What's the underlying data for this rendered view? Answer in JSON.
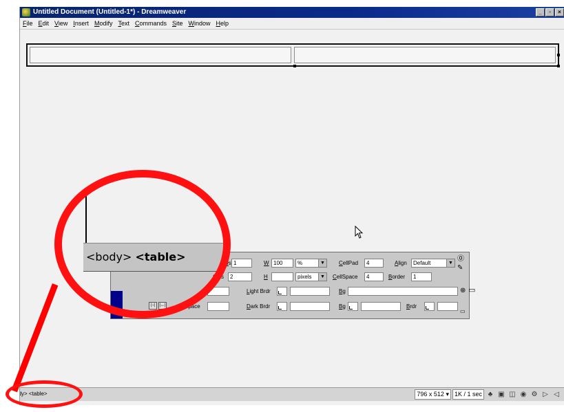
{
  "window": {
    "title": "Untitled Document (Untitled-1*) - Dreamweaver",
    "controls": [
      "_",
      "▫",
      "×"
    ]
  },
  "menu": [
    "File",
    "Edit",
    "View",
    "Insert",
    "Modify",
    "Text",
    "Commands",
    "Site",
    "Window",
    "Help"
  ],
  "properties": {
    "rows_label": "ws",
    "rows_value": "1",
    "w_label": "W",
    "w_value": "100",
    "w_unit": "%",
    "cellpad_label": "CellPad",
    "cellpad_value": "4",
    "align_label": "Align",
    "align_value": "Default",
    "cols_label": "Cols",
    "cols_value": "2",
    "h_label": "H",
    "h_unit": "pixels",
    "cellspace_label": "CellSpace",
    "cellspace_value": "4",
    "border_label": "Border",
    "border_value": "1",
    "light_brdr_label": "Light Brdr",
    "bg_image_label": "Bg",
    "dark_brdr_label": "Dark Brdr",
    "bg_color_label": "Bg",
    "brdr_label": "Brdr",
    "hspace_label": "H Space"
  },
  "status": {
    "tag_selector": "<body> <table>",
    "window_size": "796 x 512",
    "download": "1K / 1 sec"
  },
  "zoom": {
    "body_tag": "<body>",
    "table_tag": "<table>"
  },
  "colors": {
    "titlebar": "#08246b",
    "callout": "#ff1111",
    "panel_accent": "#00008b"
  }
}
